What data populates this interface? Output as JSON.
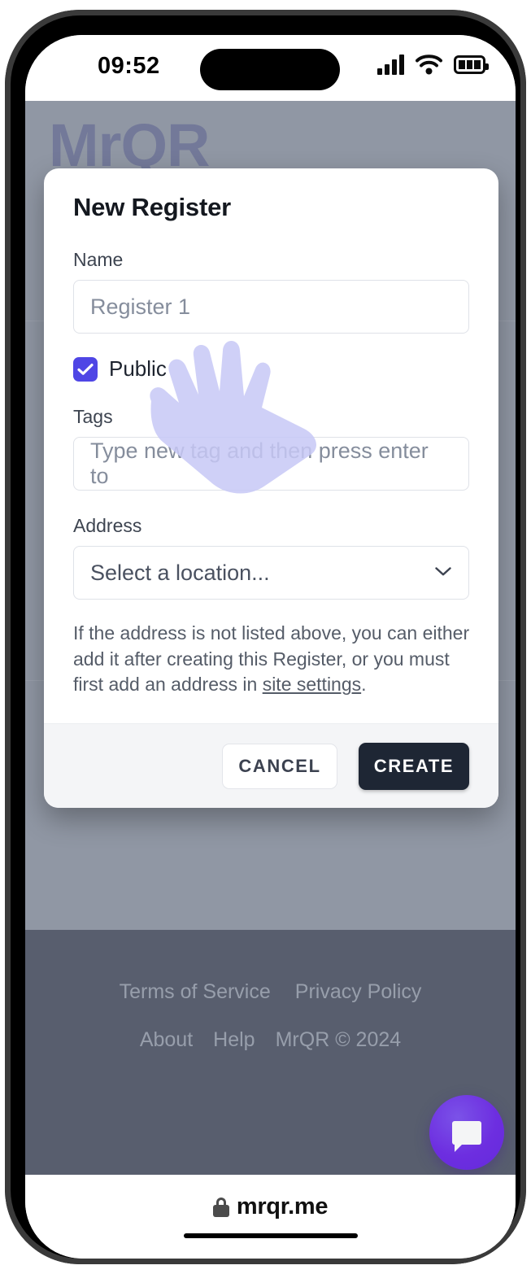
{
  "status_bar": {
    "time": "09:52",
    "icons": [
      "signal-bars-icon",
      "wifi-icon",
      "battery-icon"
    ]
  },
  "background_page": {
    "brand": "MrQR",
    "footer": {
      "row1": [
        {
          "label": "Terms of Service",
          "name": "terms-of-service-link"
        },
        {
          "label": "Privacy Policy",
          "name": "privacy-policy-link"
        }
      ],
      "row2": [
        {
          "label": "About",
          "name": "about-link"
        },
        {
          "label": "Help",
          "name": "help-link"
        }
      ],
      "copyright": "MrQR © 2024"
    },
    "chat_button": {
      "icon": "chat-bubble-icon"
    }
  },
  "modal": {
    "title": "New Register",
    "fields": {
      "name": {
        "label": "Name",
        "value": "Register 1",
        "placeholder": "Register 1"
      },
      "public": {
        "label": "Public",
        "checked": true
      },
      "tags": {
        "label": "Tags",
        "value": "",
        "placeholder": "Type new tag and then press enter to"
      },
      "address": {
        "label": "Address",
        "value": "Select a location...",
        "options": [
          "Select a location..."
        ]
      }
    },
    "helper_text_before": "If the address is not listed above, you can either add it after creating this Register, or you must first add an address in ",
    "helper_link": "site settings",
    "helper_text_after": ".",
    "buttons": {
      "cancel": "CANCEL",
      "create": "CREATE"
    }
  },
  "browser": {
    "lock_icon": "lock-icon",
    "url": "mrqr.me"
  },
  "colors": {
    "accent_indigo": "#4f46e5",
    "create_button": "#1e2634",
    "chat_fab": "#6d28e8",
    "backdrop": "#9399a6",
    "site_footer": "#565c6c",
    "cursor": "#c5c6f5"
  }
}
